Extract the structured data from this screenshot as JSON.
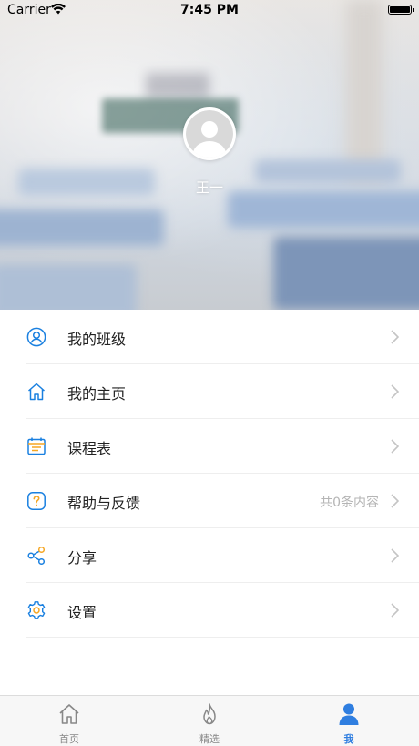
{
  "status_bar": {
    "carrier": "Carrier",
    "time": "7:45 PM"
  },
  "profile": {
    "name": "王一"
  },
  "menu": {
    "items": [
      {
        "label": "我的班级",
        "icon": "user-circle-icon",
        "extra": ""
      },
      {
        "label": "我的主页",
        "icon": "home-icon",
        "extra": ""
      },
      {
        "label": "课程表",
        "icon": "calendar-icon",
        "extra": ""
      },
      {
        "label": "帮助与反馈",
        "icon": "help-icon",
        "extra": "共0条内容"
      },
      {
        "label": "分享",
        "icon": "share-icon",
        "extra": ""
      },
      {
        "label": "设置",
        "icon": "settings-gear-icon",
        "extra": ""
      }
    ]
  },
  "tabbar": {
    "tabs": [
      {
        "label": "首页",
        "icon": "home-icon"
      },
      {
        "label": "精选",
        "icon": "flame-icon"
      },
      {
        "label": "我",
        "icon": "person-icon",
        "active": true
      }
    ]
  },
  "colors": {
    "accent": "#2f7ee0",
    "icon_blue": "#1a80e0",
    "text": "#222222",
    "muted": "#b5b5b5"
  }
}
